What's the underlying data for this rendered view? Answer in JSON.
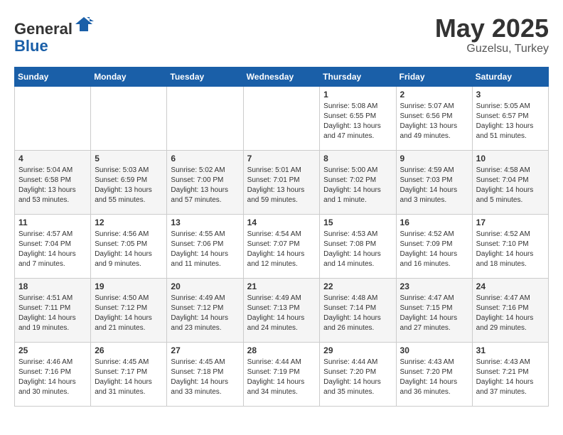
{
  "logo": {
    "general": "General",
    "blue": "Blue"
  },
  "header": {
    "month": "May 2025",
    "location": "Guzelsu, Turkey"
  },
  "days_of_week": [
    "Sunday",
    "Monday",
    "Tuesday",
    "Wednesday",
    "Thursday",
    "Friday",
    "Saturday"
  ],
  "weeks": [
    [
      {
        "day": "",
        "info": ""
      },
      {
        "day": "",
        "info": ""
      },
      {
        "day": "",
        "info": ""
      },
      {
        "day": "",
        "info": ""
      },
      {
        "day": "1",
        "info": "Sunrise: 5:08 AM\nSunset: 6:55 PM\nDaylight: 13 hours\nand 47 minutes."
      },
      {
        "day": "2",
        "info": "Sunrise: 5:07 AM\nSunset: 6:56 PM\nDaylight: 13 hours\nand 49 minutes."
      },
      {
        "day": "3",
        "info": "Sunrise: 5:05 AM\nSunset: 6:57 PM\nDaylight: 13 hours\nand 51 minutes."
      }
    ],
    [
      {
        "day": "4",
        "info": "Sunrise: 5:04 AM\nSunset: 6:58 PM\nDaylight: 13 hours\nand 53 minutes."
      },
      {
        "day": "5",
        "info": "Sunrise: 5:03 AM\nSunset: 6:59 PM\nDaylight: 13 hours\nand 55 minutes."
      },
      {
        "day": "6",
        "info": "Sunrise: 5:02 AM\nSunset: 7:00 PM\nDaylight: 13 hours\nand 57 minutes."
      },
      {
        "day": "7",
        "info": "Sunrise: 5:01 AM\nSunset: 7:01 PM\nDaylight: 13 hours\nand 59 minutes."
      },
      {
        "day": "8",
        "info": "Sunrise: 5:00 AM\nSunset: 7:02 PM\nDaylight: 14 hours\nand 1 minute."
      },
      {
        "day": "9",
        "info": "Sunrise: 4:59 AM\nSunset: 7:03 PM\nDaylight: 14 hours\nand 3 minutes."
      },
      {
        "day": "10",
        "info": "Sunrise: 4:58 AM\nSunset: 7:04 PM\nDaylight: 14 hours\nand 5 minutes."
      }
    ],
    [
      {
        "day": "11",
        "info": "Sunrise: 4:57 AM\nSunset: 7:04 PM\nDaylight: 14 hours\nand 7 minutes."
      },
      {
        "day": "12",
        "info": "Sunrise: 4:56 AM\nSunset: 7:05 PM\nDaylight: 14 hours\nand 9 minutes."
      },
      {
        "day": "13",
        "info": "Sunrise: 4:55 AM\nSunset: 7:06 PM\nDaylight: 14 hours\nand 11 minutes."
      },
      {
        "day": "14",
        "info": "Sunrise: 4:54 AM\nSunset: 7:07 PM\nDaylight: 14 hours\nand 12 minutes."
      },
      {
        "day": "15",
        "info": "Sunrise: 4:53 AM\nSunset: 7:08 PM\nDaylight: 14 hours\nand 14 minutes."
      },
      {
        "day": "16",
        "info": "Sunrise: 4:52 AM\nSunset: 7:09 PM\nDaylight: 14 hours\nand 16 minutes."
      },
      {
        "day": "17",
        "info": "Sunrise: 4:52 AM\nSunset: 7:10 PM\nDaylight: 14 hours\nand 18 minutes."
      }
    ],
    [
      {
        "day": "18",
        "info": "Sunrise: 4:51 AM\nSunset: 7:11 PM\nDaylight: 14 hours\nand 19 minutes."
      },
      {
        "day": "19",
        "info": "Sunrise: 4:50 AM\nSunset: 7:12 PM\nDaylight: 14 hours\nand 21 minutes."
      },
      {
        "day": "20",
        "info": "Sunrise: 4:49 AM\nSunset: 7:12 PM\nDaylight: 14 hours\nand 23 minutes."
      },
      {
        "day": "21",
        "info": "Sunrise: 4:49 AM\nSunset: 7:13 PM\nDaylight: 14 hours\nand 24 minutes."
      },
      {
        "day": "22",
        "info": "Sunrise: 4:48 AM\nSunset: 7:14 PM\nDaylight: 14 hours\nand 26 minutes."
      },
      {
        "day": "23",
        "info": "Sunrise: 4:47 AM\nSunset: 7:15 PM\nDaylight: 14 hours\nand 27 minutes."
      },
      {
        "day": "24",
        "info": "Sunrise: 4:47 AM\nSunset: 7:16 PM\nDaylight: 14 hours\nand 29 minutes."
      }
    ],
    [
      {
        "day": "25",
        "info": "Sunrise: 4:46 AM\nSunset: 7:16 PM\nDaylight: 14 hours\nand 30 minutes."
      },
      {
        "day": "26",
        "info": "Sunrise: 4:45 AM\nSunset: 7:17 PM\nDaylight: 14 hours\nand 31 minutes."
      },
      {
        "day": "27",
        "info": "Sunrise: 4:45 AM\nSunset: 7:18 PM\nDaylight: 14 hours\nand 33 minutes."
      },
      {
        "day": "28",
        "info": "Sunrise: 4:44 AM\nSunset: 7:19 PM\nDaylight: 14 hours\nand 34 minutes."
      },
      {
        "day": "29",
        "info": "Sunrise: 4:44 AM\nSunset: 7:20 PM\nDaylight: 14 hours\nand 35 minutes."
      },
      {
        "day": "30",
        "info": "Sunrise: 4:43 AM\nSunset: 7:20 PM\nDaylight: 14 hours\nand 36 minutes."
      },
      {
        "day": "31",
        "info": "Sunrise: 4:43 AM\nSunset: 7:21 PM\nDaylight: 14 hours\nand 37 minutes."
      }
    ]
  ]
}
